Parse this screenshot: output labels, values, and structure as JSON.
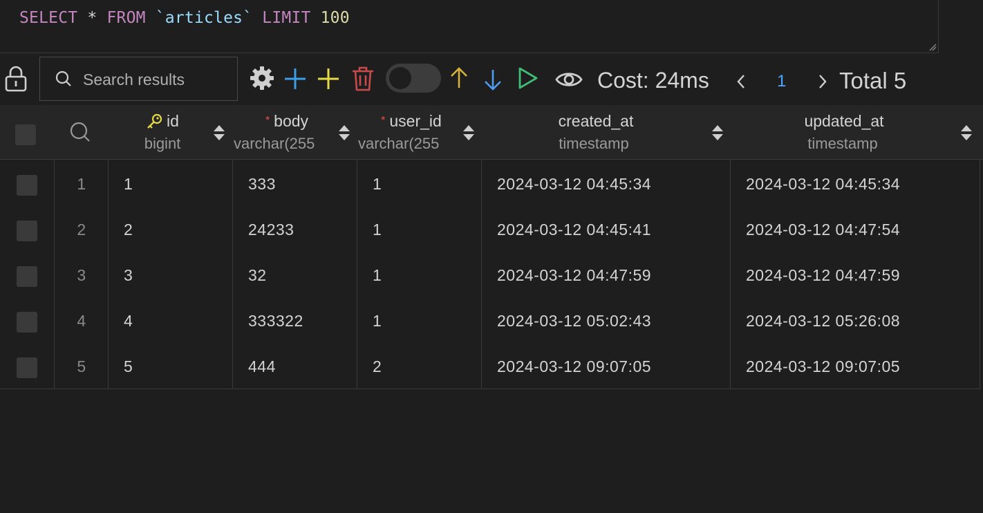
{
  "editor": {
    "sql_select": "SELECT",
    "sql_star": "*",
    "sql_from": "FROM",
    "sql_table": "`articles`",
    "sql_limit": "LIMIT",
    "sql_limit_value": "100"
  },
  "toolbar": {
    "search_placeholder": "Search results",
    "cost_label": "Cost: 24ms",
    "page": "1",
    "total_label": "Total 5",
    "icons": [
      "lock-icon",
      "search-icon",
      "gear-icon",
      "plus-icon",
      "plus-icon",
      "trash-icon",
      "toggle",
      "arrow-up-icon",
      "arrow-down-icon",
      "play-icon",
      "eye-icon",
      "chevron-left-icon",
      "chevron-right-icon"
    ],
    "colors": {
      "blue": "#3b9ee6",
      "yellow": "#e5d94a",
      "red": "#c94a4a",
      "gold": "#d7b23d",
      "down": "#4f9cf0",
      "green": "#3fbf77"
    }
  },
  "columns": [
    {
      "name": "id",
      "type": "bigint",
      "key": true
    },
    {
      "name": "body",
      "type": "varchar(255",
      "required": true
    },
    {
      "name": "user_id",
      "type": "varchar(255",
      "required": true
    },
    {
      "name": "created_at",
      "type": "timestamp"
    },
    {
      "name": "updated_at",
      "type": "timestamp"
    }
  ],
  "rows": [
    {
      "num": "1",
      "id": "1",
      "body": "333",
      "user_id": "1",
      "created_at": "2024-03-12 04:45:34",
      "updated_at": "2024-03-12 04:45:34"
    },
    {
      "num": "2",
      "id": "2",
      "body": "24233",
      "user_id": "1",
      "created_at": "2024-03-12 04:45:41",
      "updated_at": "2024-03-12 04:47:54"
    },
    {
      "num": "3",
      "id": "3",
      "body": "32",
      "user_id": "1",
      "created_at": "2024-03-12 04:47:59",
      "updated_at": "2024-03-12 04:47:59"
    },
    {
      "num": "4",
      "id": "4",
      "body": "333322",
      "user_id": "1",
      "created_at": "2024-03-12 05:02:43",
      "updated_at": "2024-03-12 05:26:08"
    },
    {
      "num": "5",
      "id": "5",
      "body": "444",
      "user_id": "2",
      "created_at": "2024-03-12 09:07:05",
      "updated_at": "2024-03-12 09:07:05"
    }
  ]
}
